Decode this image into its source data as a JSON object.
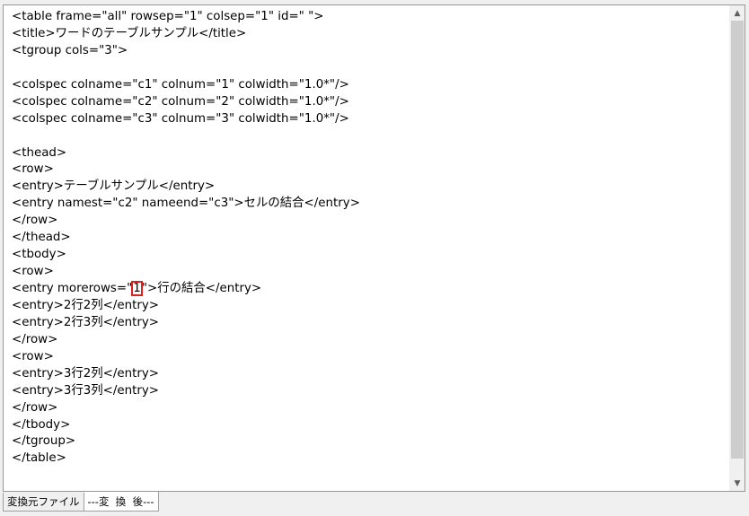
{
  "editor": {
    "lines": [
      "<table frame=\"all\" rowsep=\"1\" colsep=\"1\" id=\" \">",
      "<title>ワードのテーブルサンプル</title>",
      "<tgroup cols=\"3\">",
      "",
      "<colspec colname=\"c1\" colnum=\"1\" colwidth=\"1.0*\"/>",
      "<colspec colname=\"c2\" colnum=\"2\" colwidth=\"1.0*\"/>",
      "<colspec colname=\"c3\" colnum=\"3\" colwidth=\"1.0*\"/>",
      "",
      "<thead>",
      "<row>",
      "<entry>テーブルサンプル</entry>",
      "<entry namest=\"c2\" nameend=\"c3\">セルの結合</entry>",
      "</row>",
      "</thead>",
      "<tbody>",
      "<row>",
      null,
      "<entry>2行2列</entry>",
      "<entry>2行3列</entry>",
      "</row>",
      "<row>",
      "<entry>3行2列</entry>",
      "<entry>3行3列</entry>",
      "</row>",
      "</tbody>",
      "</tgroup>",
      "</table>"
    ],
    "highlight_line": {
      "before": "<entry morerows=\"",
      "highlight": "1",
      "after": "\">行の結合</entry>"
    }
  },
  "tabs": {
    "source_label": "変換元ファイル",
    "converted_label": "---変  換  後---"
  },
  "colors": {
    "highlight_border": "#e0201c",
    "editor_border": "#7a9cc6"
  }
}
